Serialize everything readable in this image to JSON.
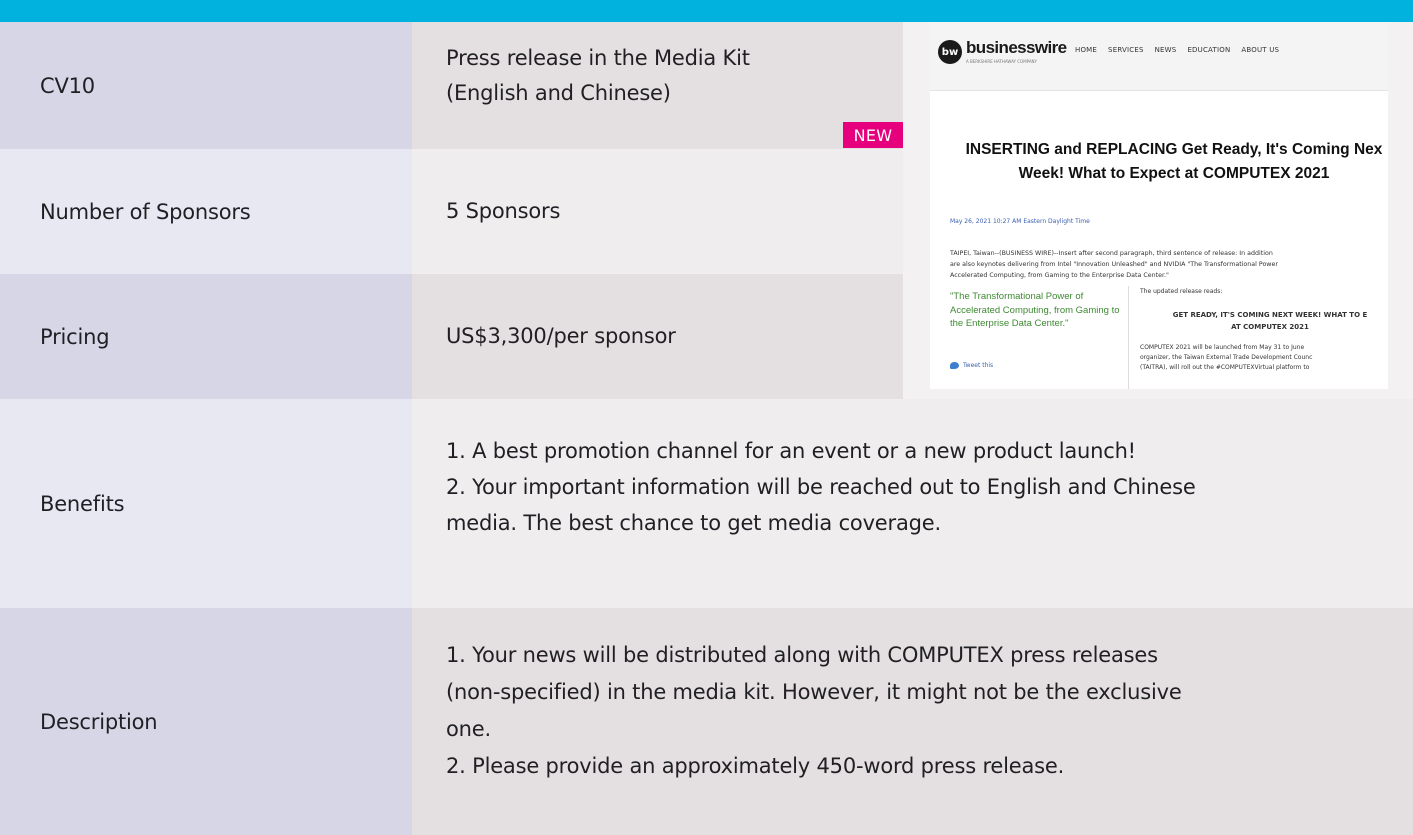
{
  "rows": {
    "code": {
      "label": "CV10",
      "value_line1": "Press release in the Media Kit",
      "value_line2": "(English and Chinese)",
      "badge": "NEW"
    },
    "sponsors": {
      "label": "Number of Sponsors",
      "value": "5 Sponsors"
    },
    "pricing": {
      "label": "Pricing",
      "value": "US$3,300/per sponsor"
    },
    "benefits": {
      "label": "Benefits",
      "lines": [
        "1. A  best promotion channel for an event or a new product launch!",
        "2. Your important information will be reached out to English and Chinese",
        "media. The best chance to get media coverage."
      ]
    },
    "description": {
      "label": "Description",
      "lines": [
        "1. Your news will be distributed along with COMPUTEX press releases",
        "(non-specified) in the media kit. However, it  might not be the exclusive",
        "one.",
        "2. Please provide an approximately 450-word press release."
      ]
    }
  },
  "preview": {
    "logo_mark": "bw",
    "logo_text": "businesswire",
    "tagline": "A BERKSHIRE HATHAWAY COMPANY",
    "nav": [
      "HOME",
      "SERVICES",
      "NEWS",
      "EDUCATION",
      "ABOUT US"
    ],
    "headline_line1": "INSERTING and REPLACING Get Ready, It's Coming Nex",
    "headline_line2": "Week! What to Expect at COMPUTEX 2021",
    "dateline": "May 26, 2021 10:27 AM Eastern Daylight Time",
    "para_line1": "TAIPEI, Taiwan--(BUSINESS WIRE)--Insert after second paragraph, third sentence of release: In addition",
    "para_line2": "are also keynotes delivering from Intel \"Innovation Unleashed\" and NVIDIA \"The Transformational Power",
    "para_line3": "Accelerated Computing, from Gaming to the Enterprise Data Center.\"",
    "quote": "\"The Transformational Power of Accelerated Computing, from Gaming to the Enterprise Data Center.\"",
    "tweet": "Tweet this",
    "updated": "The updated release reads:",
    "caps_line1": "GET READY, IT'S COMING NEXT WEEK! WHAT TO E",
    "caps_line2": "AT COMPUTEX 2021",
    "body_line1": "COMPUTEX 2021 will be launched from May 31 to June",
    "body_line2": "organizer, the Taiwan External Trade Development Counc",
    "body_line3": "(TAITRA), will roll out the #COMPUTEXVirtual platform to"
  },
  "colors": {
    "topbar": "#00b2dd",
    "badge": "#e6007e",
    "label_col_dark": "#d6d6e6",
    "value_col_dark": "#e4e0e1",
    "label_col_light": "#e8e8f2",
    "value_col_light": "#efedee"
  }
}
